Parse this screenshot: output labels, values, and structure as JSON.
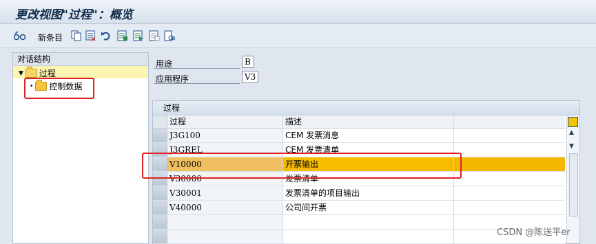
{
  "window": {
    "title": "更改视图\"过程\"：概览"
  },
  "toolbar": {
    "new_entries_label": "新条目"
  },
  "tree": {
    "header": "对话结构",
    "root": {
      "label": "过程"
    },
    "child": {
      "label": "控制数据"
    }
  },
  "fields": [
    {
      "label": "用途",
      "value": "B"
    },
    {
      "label": "应用程序",
      "value": "V3"
    }
  ],
  "table": {
    "title": "过程",
    "columns": [
      "过程",
      "描述"
    ],
    "rows": [
      {
        "code": "J3G100",
        "desc": "CEM 发票消息"
      },
      {
        "code": "J3GREL",
        "desc": "CEM 发票清单"
      },
      {
        "code": "V10000",
        "desc": "开票输出"
      },
      {
        "code": "V30000",
        "desc": "发票清单"
      },
      {
        "code": "V30001",
        "desc": "发票清单的项目输出"
      },
      {
        "code": "V40000",
        "desc": "公司间开票"
      }
    ]
  },
  "watermark": "CSDN @陈送平er",
  "colors": {
    "highlight_row": "#f5b800",
    "annotation_red": "#e02020"
  }
}
